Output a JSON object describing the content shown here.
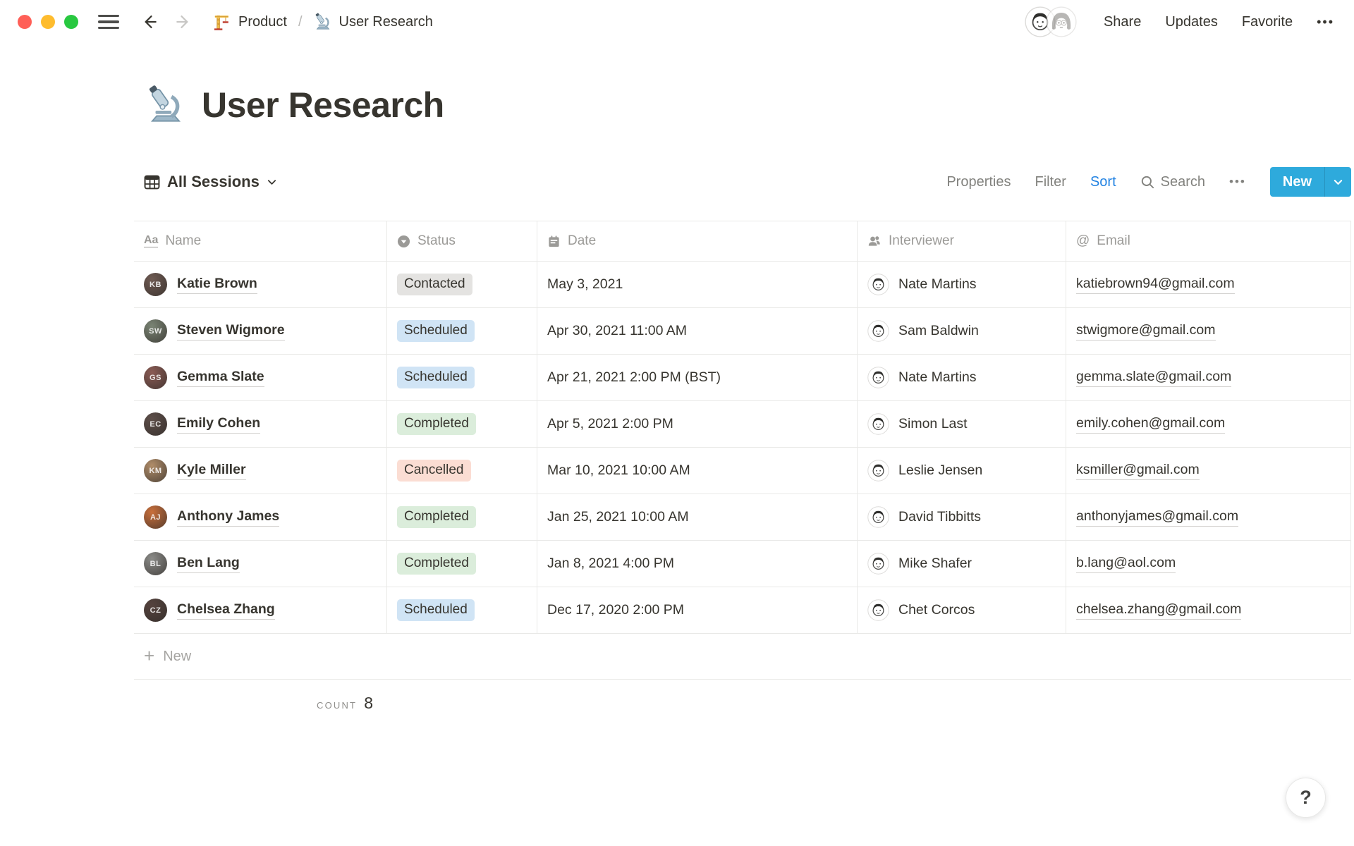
{
  "window": {
    "traffic_lights": {
      "close": "#FF5F57",
      "minimize": "#FEBC2E",
      "zoom": "#28C840"
    }
  },
  "topbar": {
    "breadcrumb": {
      "parent_label": "Product",
      "separator": "/",
      "current_label": "User Research"
    },
    "actions": {
      "share": "Share",
      "updates": "Updates",
      "favorite": "Favorite"
    },
    "more_label": "•••"
  },
  "page": {
    "title": "User Research",
    "emoji_icon": "microscope-icon"
  },
  "toolbar": {
    "view_label": "All Sessions",
    "properties_label": "Properties",
    "filter_label": "Filter",
    "sort_label": "Sort",
    "search_label": "Search",
    "more_label": "•••",
    "new_label": "New",
    "sort_active_color": "#2383E2",
    "new_button_color": "#2EAADC"
  },
  "icons": {
    "text_property": "Aa",
    "email_property": "@",
    "plus": "+",
    "help": "?"
  },
  "table": {
    "columns": [
      {
        "label": "Name",
        "icon": "text-property-icon"
      },
      {
        "label": "Status",
        "icon": "select-property-icon"
      },
      {
        "label": "Date",
        "icon": "calendar-icon"
      },
      {
        "label": "Interviewer",
        "icon": "person-icon"
      },
      {
        "label": "Email",
        "icon": "at-icon"
      }
    ],
    "status_colors": {
      "Contacted": "#E4E3E1",
      "Scheduled": "#D0E4F5",
      "Completed": "#DBEDDB",
      "Cancelled": "#FBDDD3"
    },
    "rows": [
      {
        "name": "Katie Brown",
        "avatar_color": "#6E5A52",
        "status": "Contacted",
        "date": "May 3, 2021",
        "interviewer": "Nate Martins",
        "email": "katiebrown94@gmail.com"
      },
      {
        "name": "Steven Wigmore",
        "avatar_color": "#7A8474",
        "status": "Scheduled",
        "date": "Apr 30, 2021 11:00 AM",
        "interviewer": "Sam Baldwin",
        "email": "stwigmore@gmail.com"
      },
      {
        "name": "Gemma Slate",
        "avatar_color": "#8A5B54",
        "status": "Scheduled",
        "date": "Apr 21, 2021 2:00 PM (BST)",
        "interviewer": "Nate Martins",
        "email": "gemma.slate@gmail.com"
      },
      {
        "name": "Emily Cohen",
        "avatar_color": "#5D4E49",
        "status": "Completed",
        "date": "Apr 5, 2021 2:00 PM",
        "interviewer": "Simon Last",
        "email": "emily.cohen@gmail.com"
      },
      {
        "name": "Kyle Miller",
        "avatar_color": "#B08D69",
        "status": "Cancelled",
        "date": "Mar 10, 2021 10:00 AM",
        "interviewer": "Leslie Jensen",
        "email": "ksmiller@gmail.com"
      },
      {
        "name": "Anthony James",
        "avatar_color": "#C96F3B",
        "status": "Completed",
        "date": "Jan 25, 2021 10:00 AM",
        "interviewer": "David Tibbitts",
        "email": "anthonyjames@gmail.com"
      },
      {
        "name": "Ben Lang",
        "avatar_color": "#8B8B88",
        "status": "Completed",
        "date": "Jan 8, 2021 4:00 PM",
        "interviewer": "Mike Shafer",
        "email": "b.lang@aol.com"
      },
      {
        "name": "Chelsea Zhang",
        "avatar_color": "#55433E",
        "status": "Scheduled",
        "date": "Dec 17, 2020 2:00 PM",
        "interviewer": "Chet Corcos",
        "email": "chelsea.zhang@gmail.com"
      }
    ],
    "new_row_label": "New",
    "footer": {
      "count_label": "COUNT",
      "count_value": "8"
    }
  }
}
